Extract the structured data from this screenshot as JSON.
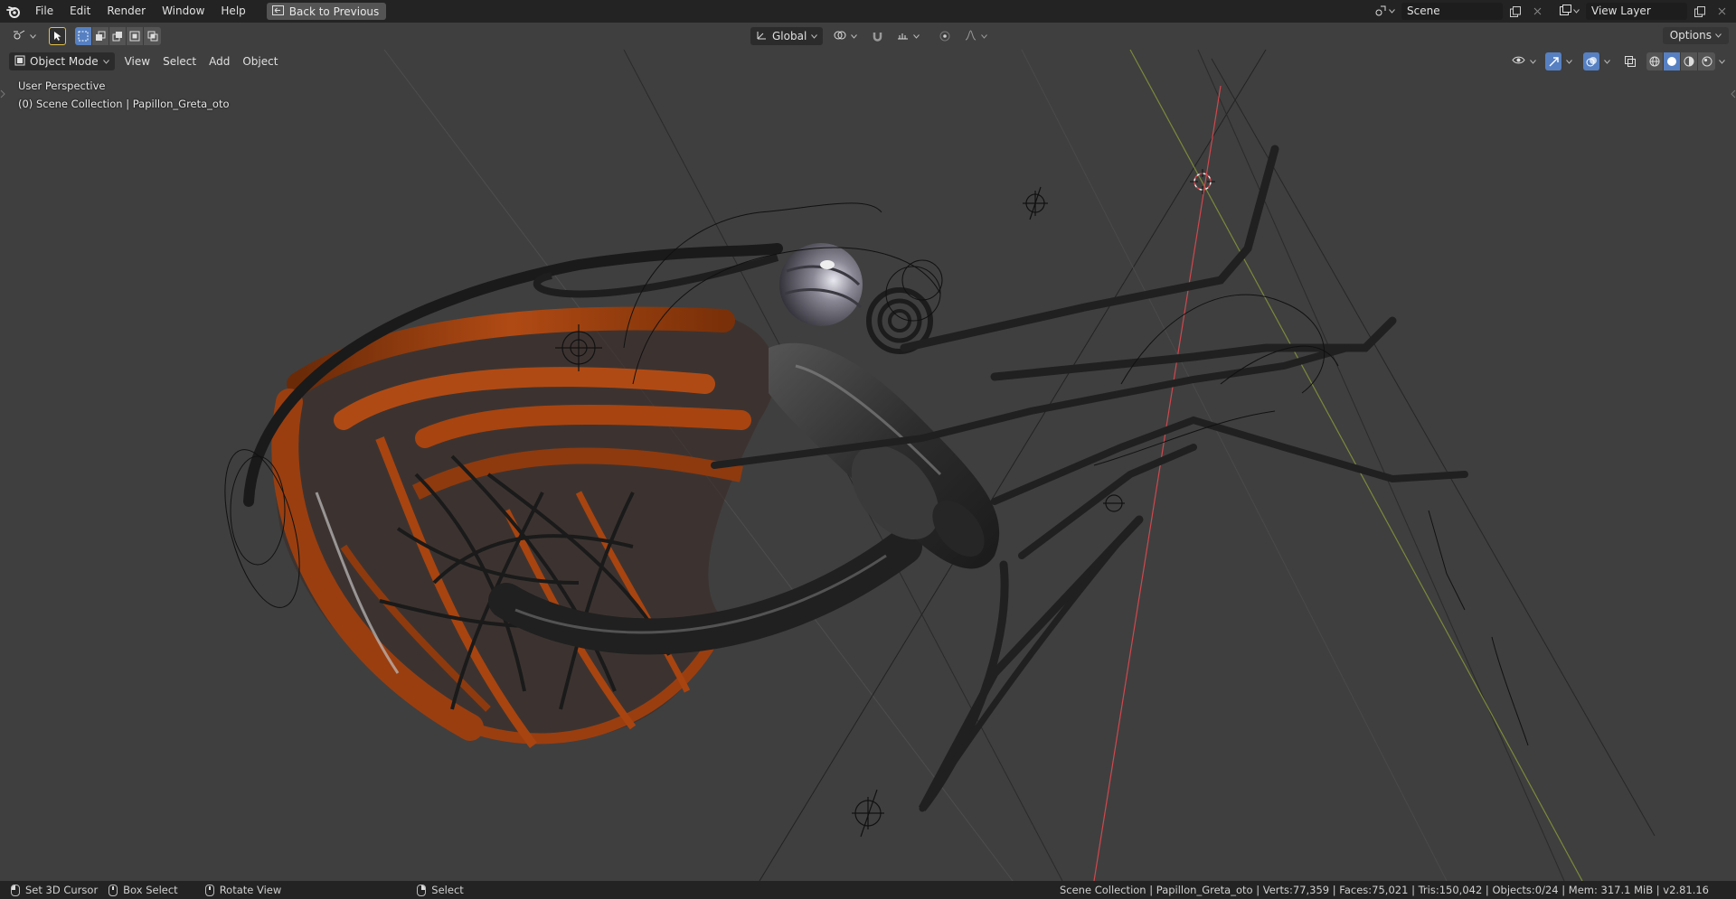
{
  "topbar": {
    "menus": [
      "File",
      "Edit",
      "Render",
      "Window",
      "Help"
    ],
    "back_label": "Back to Previous",
    "scene_name": "Scene",
    "view_layer": "View Layer"
  },
  "tool_header": {
    "orientation": "Global"
  },
  "viewport_header": {
    "mode": "Object Mode",
    "menus": [
      "View",
      "Select",
      "Add",
      "Object"
    ],
    "options_label": "Options"
  },
  "overlay": {
    "perspective": "User Perspective",
    "collection": "(0) Scene Collection | Papillon_Greta_oto"
  },
  "statusbar": {
    "hint_cursor": "Set 3D Cursor",
    "hint_box": "Box Select",
    "hint_rotate": "Rotate View",
    "hint_select": "Select",
    "stats": "Scene Collection | Papillon_Greta_oto | Verts:77,359 | Faces:75,021 | Tris:150,042 | Objects:0/24 | Mem: 317.1 MiB | v2.81.16"
  },
  "colors": {
    "accent": "#5680c2",
    "wing_orange": "#a84410",
    "body_dark": "#2a2a2a",
    "axis_red": "#d0484e",
    "axis_green": "#8c9a3a"
  }
}
